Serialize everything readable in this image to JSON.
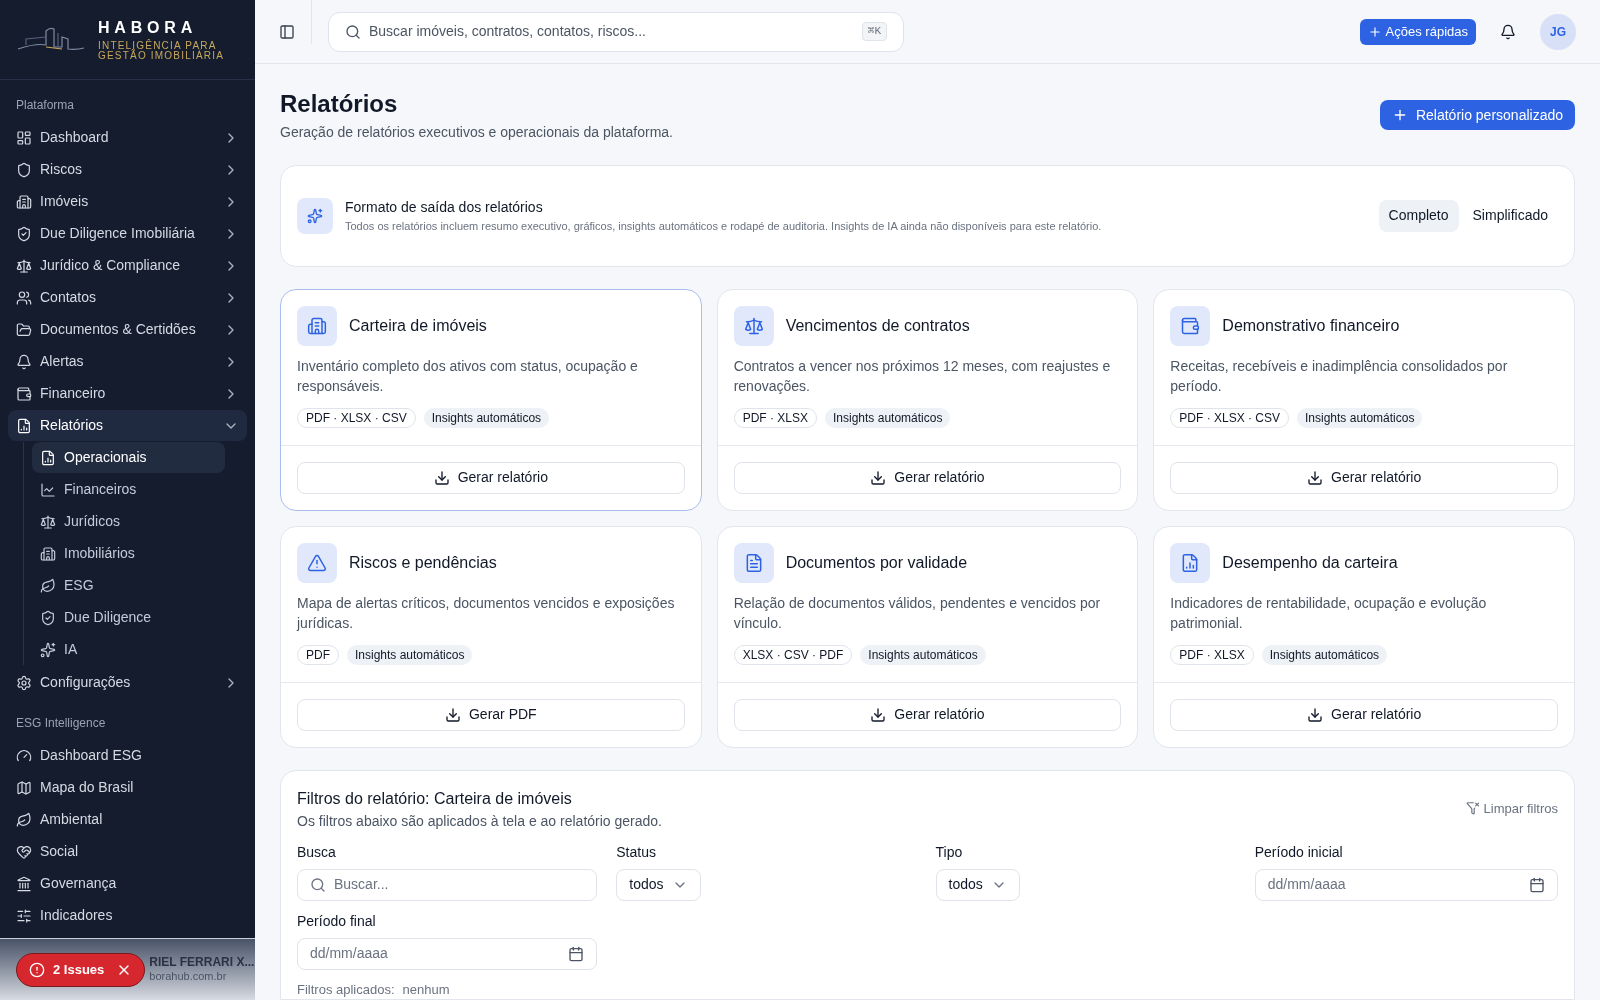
{
  "brand": {
    "name": "HABORA",
    "tagline_1": "INTELIGÊNCIA PARA",
    "tagline_2": "GESTÃO IMOBILIÁRIA"
  },
  "sidebar": {
    "sections": [
      {
        "title": "Plataforma",
        "items": [
          {
            "label": "Dashboard",
            "selected": false,
            "expanded": false
          },
          {
            "label": "Riscos",
            "selected": false,
            "expanded": false
          },
          {
            "label": "Imóveis",
            "selected": false,
            "expanded": false
          },
          {
            "label": "Due Diligence Imobiliária",
            "selected": false,
            "expanded": false
          },
          {
            "label": "Jurídico & Compliance",
            "selected": false,
            "expanded": false
          },
          {
            "label": "Contatos",
            "selected": false,
            "expanded": false
          },
          {
            "label": "Documentos & Certidões",
            "selected": false,
            "expanded": false
          },
          {
            "label": "Alertas",
            "selected": false,
            "expanded": false
          },
          {
            "label": "Financeiro",
            "selected": false,
            "expanded": false
          },
          {
            "label": "Relatórios",
            "selected": true,
            "expanded": true,
            "children": [
              {
                "label": "Operacionais",
                "selected": true
              },
              {
                "label": "Financeiros",
                "selected": false
              },
              {
                "label": "Jurídicos",
                "selected": false
              },
              {
                "label": "Imobiliários",
                "selected": false
              },
              {
                "label": "ESG",
                "selected": false
              },
              {
                "label": "Due Diligence",
                "selected": false
              },
              {
                "label": "IA",
                "selected": false
              }
            ]
          },
          {
            "label": "Configurações",
            "selected": false,
            "expanded": false
          }
        ]
      },
      {
        "title": "ESG Intelligence",
        "items": [
          {
            "label": "Dashboard ESG",
            "selected": false
          },
          {
            "label": "Mapa do Brasil",
            "selected": false
          },
          {
            "label": "Ambiental",
            "selected": false
          },
          {
            "label": "Social",
            "selected": false
          },
          {
            "label": "Governança",
            "selected": false
          },
          {
            "label": "Indicadores",
            "selected": false
          }
        ]
      }
    ],
    "user": {
      "name": "RIEL FERRARI X...",
      "email": "borahub.com.br"
    },
    "issues_badge": "2 Issues"
  },
  "header": {
    "search": {
      "placeholder": "Buscar imóveis, contratos, contatos, riscos...",
      "shortcut": "⌘K"
    },
    "quick_actions": "Ações rápidas",
    "avatar": "JG"
  },
  "page": {
    "title": "Relatórios",
    "subtitle": "Geração de relatórios executivos e operacionais da plataforma.",
    "primary_button": "Relatório personalizado"
  },
  "format": {
    "title": "Formato de saída dos relatórios",
    "description": "Todos os relatórios incluem resumo executivo, gráficos, insights automáticos e rodapé de auditoria. Insights de IA ainda não disponíveis para este relatório.",
    "options": [
      {
        "label": "Completo",
        "selected": true
      },
      {
        "label": "Simplificado",
        "selected": false
      }
    ]
  },
  "reports": [
    {
      "title": "Carteira de imóveis",
      "description": "Inventário completo dos ativos com status, ocupação e responsáveis.",
      "selected": true,
      "tags": [
        {
          "kind": "format",
          "label": "PDF · XLSX · CSV"
        },
        {
          "kind": "insight",
          "label": "Insights automáticos"
        }
      ],
      "action": "Gerar relatório"
    },
    {
      "title": "Vencimentos de contratos",
      "description": "Contratos a vencer nos próximos 12 meses, com reajustes e renovações.",
      "selected": false,
      "tags": [
        {
          "kind": "format",
          "label": "PDF · XLSX"
        },
        {
          "kind": "insight",
          "label": "Insights automáticos"
        }
      ],
      "action": "Gerar relatório"
    },
    {
      "title": "Demonstrativo financeiro",
      "description": "Receitas, recebíveis e inadimplência consolidados por período.",
      "selected": false,
      "tags": [
        {
          "kind": "format",
          "label": "PDF · XLSX · CSV"
        },
        {
          "kind": "insight",
          "label": "Insights automáticos"
        }
      ],
      "action": "Gerar relatório"
    },
    {
      "title": "Riscos e pendências",
      "description": "Mapa de alertas críticos, documentos vencidos e exposições jurídicas.",
      "selected": false,
      "tags": [
        {
          "kind": "format",
          "label": "PDF"
        },
        {
          "kind": "insight",
          "label": "Insights automáticos"
        }
      ],
      "action": "Gerar PDF"
    },
    {
      "title": "Documentos por validade",
      "description": "Relação de documentos válidos, pendentes e vencidos por vínculo.",
      "selected": false,
      "tags": [
        {
          "kind": "format",
          "label": "XLSX · CSV · PDF"
        },
        {
          "kind": "insight",
          "label": "Insights automáticos"
        }
      ],
      "action": "Gerar relatório"
    },
    {
      "title": "Desempenho da carteira",
      "description": "Indicadores de rentabilidade, ocupação e evolução patrimonial.",
      "selected": false,
      "tags": [
        {
          "kind": "format",
          "label": "PDF · XLSX"
        },
        {
          "kind": "insight",
          "label": "Insights automáticos"
        }
      ],
      "action": "Gerar relatório"
    }
  ],
  "filters": {
    "title": "Filtros do relatório: Carteira de imóveis",
    "subtitle": "Os filtros abaixo são aplicados à tela e ao relatório gerado.",
    "clear": "Limpar filtros",
    "fields": [
      {
        "kind": "search",
        "label": "Busca",
        "placeholder": "Buscar..."
      },
      {
        "kind": "select",
        "label": "Status",
        "value": "todos"
      },
      {
        "kind": "select",
        "label": "Tipo",
        "value": "todos"
      },
      {
        "kind": "date",
        "label": "Período inicial",
        "placeholder": "dd/mm/aaaa"
      },
      {
        "kind": "date",
        "label": "Período final",
        "placeholder": "dd/mm/aaaa"
      }
    ],
    "applied_label": "Filtros aplicados:",
    "applied_value": "nenhum"
  }
}
